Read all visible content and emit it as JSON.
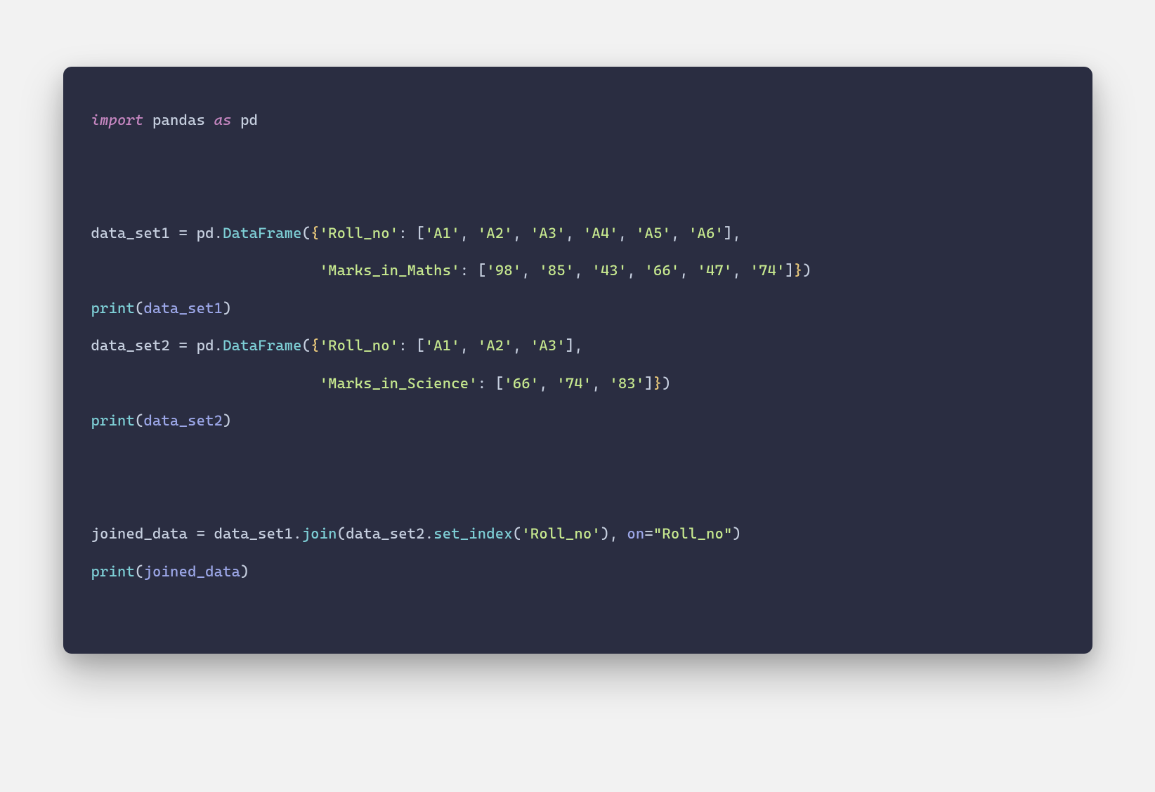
{
  "code": {
    "line1": {
      "kw_import": "import",
      "mod_pandas": "pandas",
      "kw_as": "as",
      "alias_pd": "pd"
    },
    "line3": {
      "var": "data_set1",
      "eq": " = ",
      "pd": "pd",
      "dot": ".",
      "df": "DataFrame",
      "open": "(",
      "brace_open": "{",
      "key1": "'Roll_no'",
      "colon": ": ",
      "brk_open": "[",
      "v1": "'A1'",
      "v2": "'A2'",
      "v3": "'A3'",
      "v4": "'A4'",
      "v5": "'A5'",
      "v6": "'A6'",
      "brk_close": "]",
      "comma": ","
    },
    "line4": {
      "indent": "                          ",
      "key2": "'Marks_in_Maths'",
      "colon": ": ",
      "brk_open": "[",
      "v1": "'98'",
      "v2": "'85'",
      "v3": "'43'",
      "v4": "'66'",
      "v5": "'47'",
      "v6": "'74'",
      "brk_close": "]",
      "brace_close": "}",
      "close": ")"
    },
    "line5": {
      "print": "print",
      "open": "(",
      "arg": "data_set1",
      "close": ")"
    },
    "line6": {
      "var": "data_set2",
      "eq": " = ",
      "pd": "pd",
      "dot": ".",
      "df": "DataFrame",
      "open": "(",
      "brace_open": "{",
      "key1": "'Roll_no'",
      "colon": ": ",
      "brk_open": "[",
      "v1": "'A1'",
      "v2": "'A2'",
      "v3": "'A3'",
      "brk_close": "]",
      "comma": ","
    },
    "line7": {
      "indent": "                          ",
      "key2": "'Marks_in_Science'",
      "colon": ": ",
      "brk_open": "[",
      "v1": "'66'",
      "v2": "'74'",
      "v3": "'83'",
      "brk_close": "]",
      "brace_close": "}",
      "close": ")"
    },
    "line8": {
      "print": "print",
      "open": "(",
      "arg": "data_set2",
      "close": ")"
    },
    "line10": {
      "var": "joined_data",
      "eq": " = ",
      "ds1": "data_set1",
      "dot": ".",
      "join": "join",
      "open": "(",
      "ds2": "data_set2",
      "dot2": ".",
      "setidx": "set_index",
      "open2": "(",
      "arg1": "'Roll_no'",
      "close2": ")",
      "comma": ", ",
      "on_kw": "on",
      "eq2": "=",
      "arg2": "\"Roll_no\"",
      "close": ")"
    },
    "line11": {
      "print": "print",
      "open": "(",
      "arg": "joined_data",
      "close": ")"
    }
  }
}
